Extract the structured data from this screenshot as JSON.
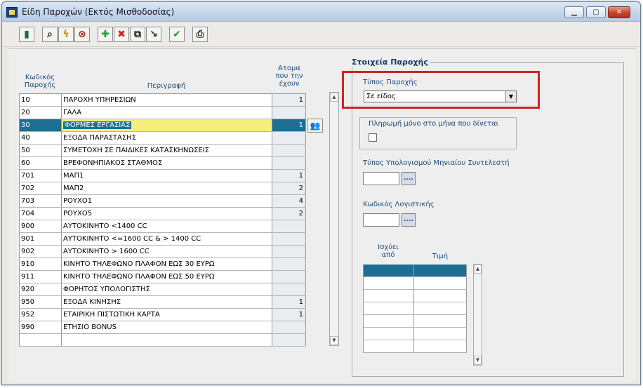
{
  "window": {
    "title": "Είδη Παροχών (Εκτός Μισθοδοσίας)",
    "controls": [
      "minimize",
      "maximize",
      "close"
    ]
  },
  "toolbar": {
    "buttons": [
      {
        "icon": "exit-door-icon",
        "glyph": "▮"
      },
      {
        "icon": "search-icon",
        "glyph": "⌕"
      },
      {
        "icon": "lightning-icon",
        "glyph": "ϟ"
      },
      {
        "icon": "cancel-circle-icon",
        "glyph": "⊗"
      },
      {
        "icon": "add-icon",
        "glyph": "✚"
      },
      {
        "icon": "delete-icon",
        "glyph": "✖"
      },
      {
        "icon": "copy-icon",
        "glyph": "⧉"
      },
      {
        "icon": "import-icon",
        "glyph": "↘"
      },
      {
        "icon": "checkmark-icon",
        "glyph": "✔"
      },
      {
        "icon": "print-icon",
        "glyph": "⎙"
      }
    ]
  },
  "table": {
    "headers": {
      "code": "Κωδικός Παροχής",
      "description": "Περιγραφή",
      "people": "Ατομα που την έχουν"
    },
    "rows": [
      {
        "code": "10",
        "desc": "ΠΑΡΟΧΗ ΥΠΗΡΕΣΙΩΝ",
        "count": "1"
      },
      {
        "code": "20",
        "desc": "ΓΑΛΑ",
        "count": ""
      },
      {
        "code": "30",
        "desc": "ΦΟΡΜΕΣ ΕΡΓΑΣΙΑΣ",
        "count": "1",
        "selected": true
      },
      {
        "code": "40",
        "desc": "ΕΞΟΔΑ ΠΑΡΑΣΤΑΣΗΣ",
        "count": ""
      },
      {
        "code": "50",
        "desc": "ΣΥΜΕΤΟΧΗ ΣΕ ΠΑΙΔΙΚΕΣ ΚΑΤΑΣΚΗΝΩΣΕΙΣ",
        "count": ""
      },
      {
        "code": "60",
        "desc": "ΒΡΕΦΟΝΗΠΙΑΚΟΣ ΣΤΑΘΜΟΣ",
        "count": ""
      },
      {
        "code": "701",
        "desc": "ΜΑΠ1",
        "count": "1"
      },
      {
        "code": "702",
        "desc": "ΜΑΠ2",
        "count": "2"
      },
      {
        "code": "703",
        "desc": "ΡΟΥΧΟ1",
        "count": "4"
      },
      {
        "code": "704",
        "desc": "ΡΟΥΧΟ5",
        "count": "2"
      },
      {
        "code": "900",
        "desc": "ΑΥΤΟΚΙΝΗΤΟ <1400 CC",
        "count": ""
      },
      {
        "code": "901",
        "desc": "ΑΥΤΟΚΙΝΗΤΟ <=1600 CC & > 1400 CC",
        "count": ""
      },
      {
        "code": "902",
        "desc": "ΑΥΤΟΚΙΝΗΤΟ  > 1600 CC",
        "count": ""
      },
      {
        "code": "910",
        "desc": "ΚΙΝΗΤΟ ΤΗΛΕΦΩΝΟ ΠΛΑΦΟΝ ΕΩΣ 30 ΕΥΡΩ",
        "count": ""
      },
      {
        "code": "911",
        "desc": "ΚΙΝΗΤΟ ΤΗΛΕΦΩΝΟ ΠΛΑΦΟΝ ΕΩΣ 50 ΕΥΡΩ",
        "count": ""
      },
      {
        "code": "920",
        "desc": "ΦΟΡΗΤΟΣ ΥΠΟΛΟΓΙΣΤΗΣ",
        "count": ""
      },
      {
        "code": "950",
        "desc": "ΕΞΟΔΑ ΚΙΝΗΣΗΣ",
        "count": "1"
      },
      {
        "code": "952",
        "desc": "ΕΤΑΙΡΙΚΗ ΠΙΣΤΩΤΙΚΗ ΚΑΡΤΑ",
        "count": "1"
      },
      {
        "code": "990",
        "desc": "ΕΤΗΣΙΟ BONUS",
        "count": ""
      },
      {
        "code": "",
        "desc": "",
        "count": ""
      }
    ]
  },
  "details": {
    "group_title": "Στοιχεία Παροχής",
    "benefit_type_label": "Τύπος Παροχής",
    "benefit_type_value": "Σε είδος",
    "pay_only_month_label": "Πληρωμή μόνο στο μήνα που δίνεται",
    "pay_only_month_checked": false,
    "monthly_factor_label": "Τύπος Υπολογισμού Μηνιαίου Συντελεστή",
    "monthly_factor_value": "",
    "accounting_code_label": "Κωδικός Λογιστικής",
    "accounting_code_value": "",
    "dots_label": "....",
    "values_grid": {
      "col_from": "Ισχύει από",
      "col_value": "Τιμή",
      "row_count": 7
    }
  },
  "colors": {
    "selection": "#1e6f94",
    "highlight": "#f5f07a",
    "callout_border": "#d32222"
  }
}
